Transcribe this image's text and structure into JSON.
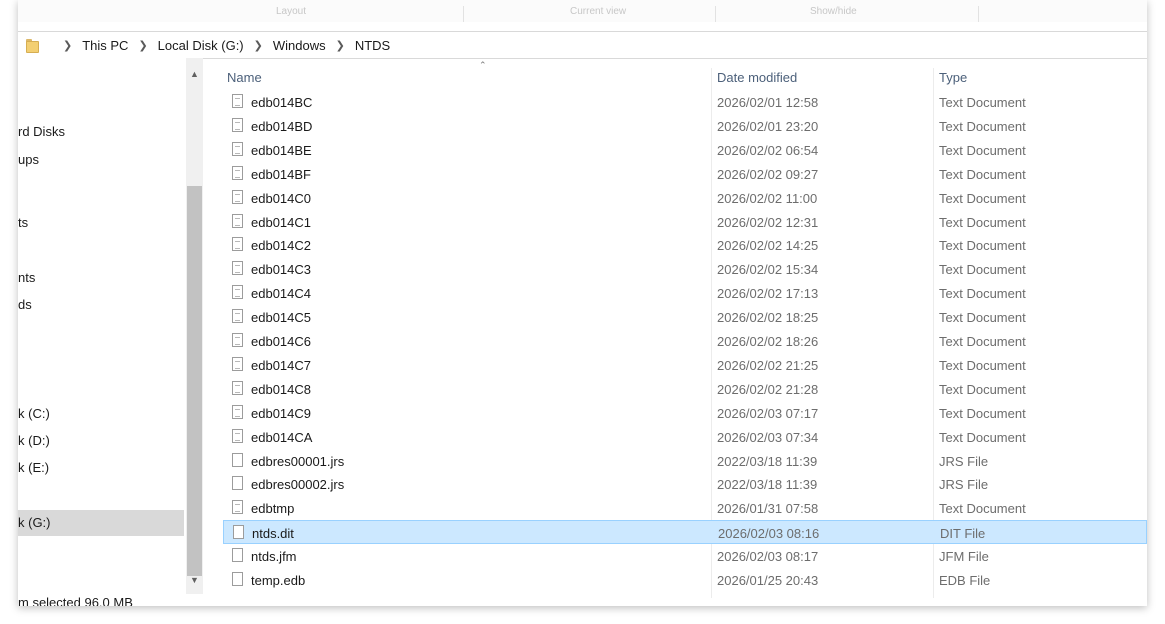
{
  "ribbon": {
    "groups": [
      "Layout",
      "Current view",
      "Show/hide"
    ]
  },
  "address": {
    "crumbs": [
      "This PC",
      "Local Disk (G:)",
      "Windows",
      "NTDS"
    ]
  },
  "nav": {
    "items": [
      {
        "label": "rd Disks"
      },
      {
        "label": "ups"
      },
      {
        "label": "ts"
      },
      {
        "label": "nts"
      },
      {
        "label": "ds"
      },
      {
        "label": "k (C:)"
      },
      {
        "label": "k (D:)"
      },
      {
        "label": "k (E:)"
      },
      {
        "label": "k (G:)"
      }
    ],
    "status": "m selected  96.0 MB"
  },
  "columns": {
    "name": "Name",
    "date": "Date modified",
    "type": "Type"
  },
  "files": [
    {
      "name": "edb014BC",
      "date": "2026/02/01 12:58",
      "type": "Text Document",
      "icon": "text-file-icon"
    },
    {
      "name": "edb014BD",
      "date": "2026/02/01 23:20",
      "type": "Text Document",
      "icon": "text-file-icon"
    },
    {
      "name": "edb014BE",
      "date": "2026/02/02 06:54",
      "type": "Text Document",
      "icon": "text-file-icon"
    },
    {
      "name": "edb014BF",
      "date": "2026/02/02 09:27",
      "type": "Text Document",
      "icon": "text-file-icon"
    },
    {
      "name": "edb014C0",
      "date": "2026/02/02 11:00",
      "type": "Text Document",
      "icon": "text-file-icon"
    },
    {
      "name": "edb014C1",
      "date": "2026/02/02 12:31",
      "type": "Text Document",
      "icon": "text-file-icon"
    },
    {
      "name": "edb014C2",
      "date": "2026/02/02 14:25",
      "type": "Text Document",
      "icon": "text-file-icon"
    },
    {
      "name": "edb014C3",
      "date": "2026/02/02 15:34",
      "type": "Text Document",
      "icon": "text-file-icon"
    },
    {
      "name": "edb014C4",
      "date": "2026/02/02 17:13",
      "type": "Text Document",
      "icon": "text-file-icon"
    },
    {
      "name": "edb014C5",
      "date": "2026/02/02 18:25",
      "type": "Text Document",
      "icon": "text-file-icon"
    },
    {
      "name": "edb014C6",
      "date": "2026/02/02 18:26",
      "type": "Text Document",
      "icon": "text-file-icon"
    },
    {
      "name": "edb014C7",
      "date": "2026/02/02 21:25",
      "type": "Text Document",
      "icon": "text-file-icon"
    },
    {
      "name": "edb014C8",
      "date": "2026/02/02 21:28",
      "type": "Text Document",
      "icon": "text-file-icon"
    },
    {
      "name": "edb014C9",
      "date": "2026/02/03 07:17",
      "type": "Text Document",
      "icon": "text-file-icon"
    },
    {
      "name": "edb014CA",
      "date": "2026/02/03 07:34",
      "type": "Text Document",
      "icon": "text-file-icon"
    },
    {
      "name": "edbres00001.jrs",
      "date": "2022/03/18 11:39",
      "type": "JRS File",
      "icon": "file-icon"
    },
    {
      "name": "edbres00002.jrs",
      "date": "2022/03/18 11:39",
      "type": "JRS File",
      "icon": "file-icon"
    },
    {
      "name": "edbtmp",
      "date": "2026/01/31 07:58",
      "type": "Text Document",
      "icon": "text-file-icon"
    },
    {
      "name": "ntds.dit",
      "date": "2026/02/03 08:16",
      "type": "DIT File",
      "icon": "file-icon",
      "selected": true
    },
    {
      "name": "ntds.jfm",
      "date": "2026/02/03 08:17",
      "type": "JFM File",
      "icon": "file-icon"
    },
    {
      "name": "temp.edb",
      "date": "2026/01/25 20:43",
      "type": "EDB File",
      "icon": "file-icon"
    }
  ],
  "colors": {
    "selection_bg": "#cce8ff",
    "selection_border": "#99d1ff",
    "header_text": "#4c607a"
  }
}
